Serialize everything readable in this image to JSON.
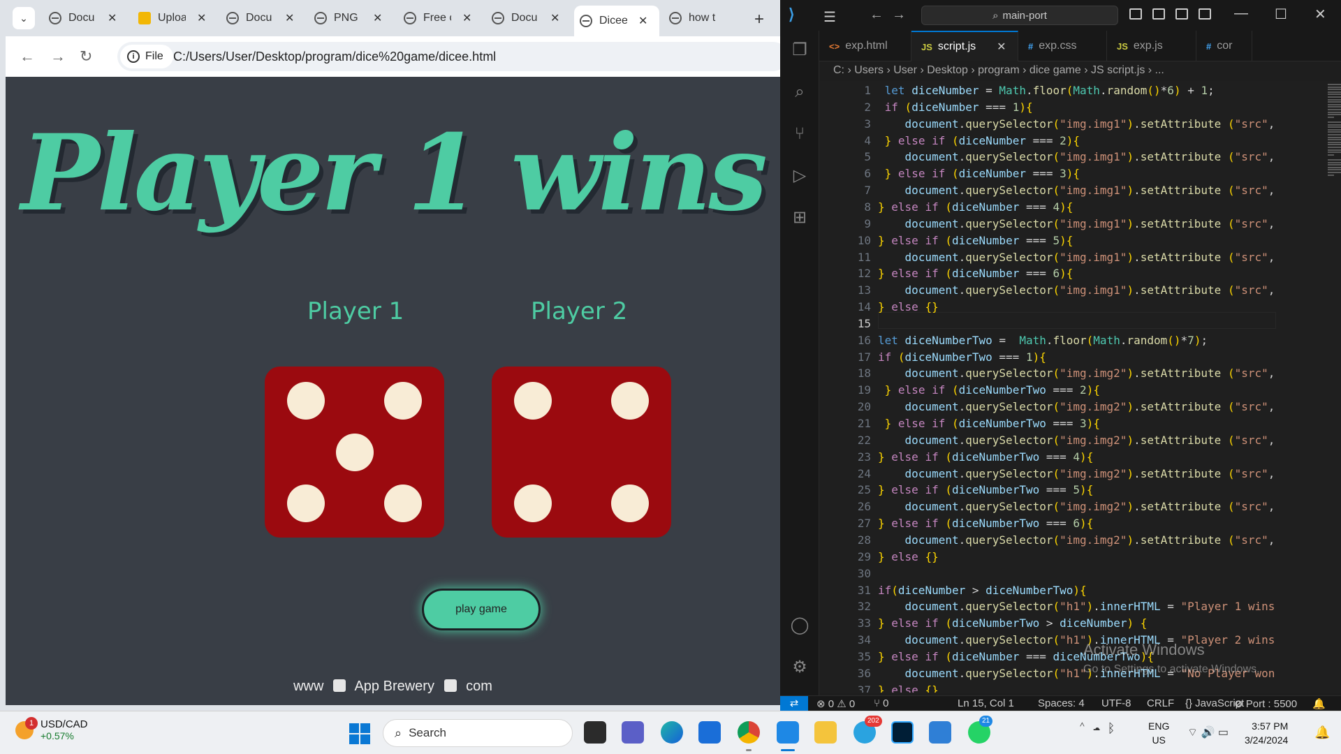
{
  "browser": {
    "tabs": [
      {
        "title": "Docu",
        "icon": "globe-icon"
      },
      {
        "title": "Uploa",
        "icon": "stack-icon"
      },
      {
        "title": "Docu",
        "icon": "globe-icon"
      },
      {
        "title": "PNG I",
        "icon": "globe-icon"
      },
      {
        "title": "Free c",
        "icon": "globe-icon"
      },
      {
        "title": "Docu",
        "icon": "globe-icon"
      },
      {
        "title": "Dicee",
        "icon": "globe-icon"
      },
      {
        "title": "how t",
        "icon": "google-icon"
      }
    ],
    "active_tab": 6,
    "address_chip": "File",
    "url": "C:/Users/User/Desktop/program/dice%20game/dicee.html"
  },
  "page": {
    "title": "Player 1 wins",
    "player1_label": "Player 1",
    "player2_label": "Player 2",
    "player1_die": 5,
    "player2_die": 4,
    "play_button": "play game",
    "footer": [
      "www",
      "App Brewery",
      "com"
    ],
    "colors": {
      "background": "#393e46",
      "accent": "#4ecca3",
      "die": "#9b0a0f",
      "pip": "#f8ecd6"
    }
  },
  "vscode": {
    "search": "main-port",
    "tabs": [
      {
        "label": "exp.html",
        "icon": "html-icon"
      },
      {
        "label": "script.js",
        "icon": "js-icon"
      },
      {
        "label": "exp.css",
        "icon": "css-icon"
      },
      {
        "label": "exp.js",
        "icon": "js-icon"
      },
      {
        "label": "cor",
        "icon": "css-icon"
      }
    ],
    "active_tab": 1,
    "breadcrumbs": "C: › Users › User › Desktop › program › dice game › JS script.js › ...",
    "current_line": 15,
    "lines": [
      " let diceNumber = Math.floor(Math.random()*6) + 1;",
      " if (diceNumber === 1){",
      "    document.querySelector(\"img.img1\").setAttribute (\"src\",",
      " } else if (diceNumber === 2){",
      "    document.querySelector(\"img.img1\").setAttribute (\"src\",",
      " } else if (diceNumber === 3){",
      "    document.querySelector(\"img.img1\").setAttribute (\"src\",",
      "} else if (diceNumber === 4){",
      "    document.querySelector(\"img.img1\").setAttribute (\"src\",",
      "} else if (diceNumber === 5){",
      "    document.querySelector(\"img.img1\").setAttribute (\"src\",",
      "} else if (diceNumber === 6){",
      "    document.querySelector(\"img.img1\").setAttribute (\"src\",",
      "} else {}",
      "",
      "let diceNumberTwo =  Math.floor(Math.random()*7);",
      "if (diceNumberTwo === 1){",
      "    document.querySelector(\"img.img2\").setAttribute (\"src\",",
      " } else if (diceNumberTwo === 2){",
      "    document.querySelector(\"img.img2\").setAttribute (\"src\",",
      " } else if (diceNumberTwo === 3){",
      "    document.querySelector(\"img.img2\").setAttribute (\"src\",",
      "} else if (diceNumberTwo === 4){",
      "    document.querySelector(\"img.img2\").setAttribute (\"src\",",
      "} else if (diceNumberTwo === 5){",
      "    document.querySelector(\"img.img2\").setAttribute (\"src\",",
      "} else if (diceNumberTwo === 6){",
      "    document.querySelector(\"img.img2\").setAttribute (\"src\",",
      "} else {}",
      "",
      "if(diceNumber > diceNumberTwo){",
      "    document.querySelector(\"h1\").innerHTML = \"Player 1 wins",
      "} else if (diceNumberTwo > diceNumber) {",
      "    document.querySelector(\"h1\").innerHTML = \"Player 2 wins",
      "} else if (diceNumber === diceNumberTwo){",
      "    document.querySelector(\"h1\").innerHTML = \"No Player won",
      "} else {}"
    ],
    "watermark_title": "Activate Windows",
    "watermark_sub": "Go to Settings to activate Windows.",
    "status": {
      "errors": "⊗ 0 ⚠ 0",
      "ports": "⑂ 0",
      "position": "Ln 15, Col 1",
      "spaces": "Spaces: 4",
      "encoding": "UTF-8",
      "eol": "CRLF",
      "language": "{} JavaScript",
      "port": "⊘ Port : 5500"
    }
  },
  "taskbar": {
    "widget_label": "USD/CAD",
    "widget_value": "+0.57%",
    "widget_badge": "1",
    "search": "Search",
    "telegram_badge": "202",
    "whatsapp_badge": "21",
    "lang": "ENG",
    "region": "US",
    "time": "3:57 PM",
    "date": "3/24/2024"
  }
}
